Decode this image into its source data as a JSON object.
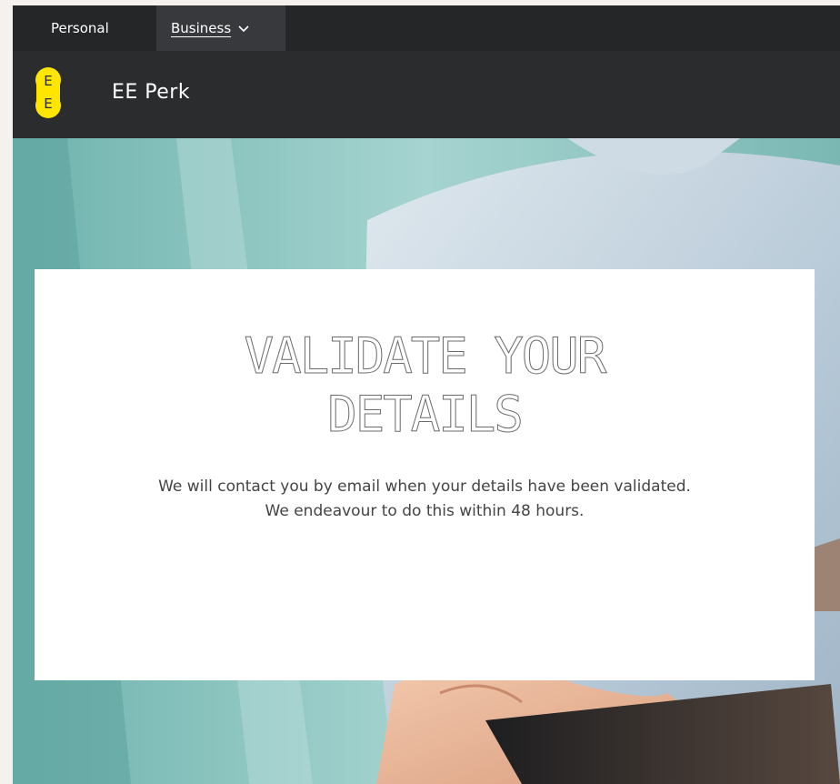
{
  "topnav": {
    "personal_label": "Personal",
    "business_label": "Business"
  },
  "brand": {
    "logo_text": "EE",
    "name": "EE Perk",
    "accent_color": "#ffe600"
  },
  "card": {
    "title_line1": "VALIDATE YOUR",
    "title_line2": "DETAILS",
    "message_line1": "We will contact you by email when your details have been validated.",
    "message_line2": "We endeavour to do this within 48 hours."
  },
  "icons": {
    "business_dropdown": "chevron-down-icon",
    "logo": "ee-logo-icon"
  }
}
